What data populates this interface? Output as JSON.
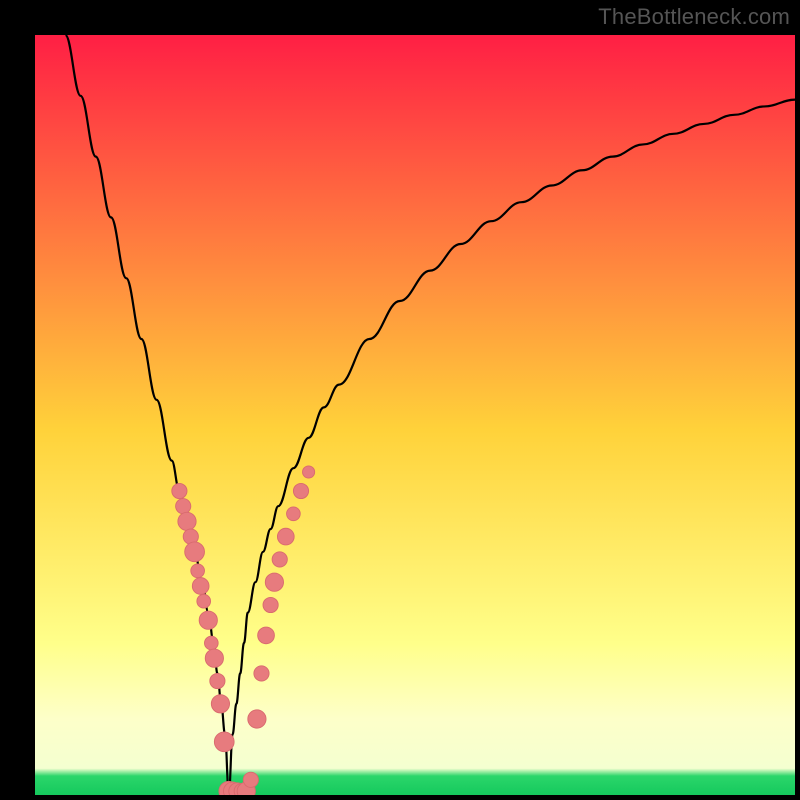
{
  "watermark": "TheBottleneck.com",
  "colors": {
    "frame": "#000000",
    "grad_top": "#ff1f44",
    "grad_mid": "#ffd23a",
    "grad_low": "#ffff8a",
    "grad_band_pale": "#fdffc9",
    "grad_green": "#2bd66a",
    "curve": "#000000",
    "marker_fill": "#e77b7e",
    "marker_stroke": "#d96a6e"
  },
  "chart_data": {
    "type": "line",
    "title": "",
    "xlabel": "",
    "ylabel": "",
    "xlim": [
      0,
      100
    ],
    "ylim": [
      0,
      100
    ],
    "minimum_x": 25.5,
    "series": [
      {
        "name": "bottleneck-curve",
        "x": [
          4,
          6,
          8,
          10,
          12,
          14,
          16,
          18,
          19,
          20,
          21,
          22,
          22.8,
          23.5,
          24,
          24.5,
          25,
          25.5,
          26,
          26.5,
          27,
          27.5,
          28,
          29,
          30,
          31,
          32,
          34,
          36,
          38,
          40,
          44,
          48,
          52,
          56,
          60,
          64,
          68,
          72,
          76,
          80,
          84,
          88,
          92,
          96,
          100
        ],
        "values": [
          100,
          92,
          84,
          76,
          68,
          60,
          52,
          44,
          40,
          36,
          32,
          28,
          24,
          20,
          16,
          12,
          8,
          0,
          8,
          12,
          16,
          20,
          24,
          28,
          32,
          35,
          38,
          43,
          47,
          51,
          54,
          60,
          65,
          69,
          72.5,
          75.5,
          78,
          80.2,
          82.2,
          84,
          85.6,
          87,
          88.3,
          89.5,
          90.6,
          91.5
        ]
      }
    ],
    "markers": [
      {
        "x": 19.0,
        "y": 40.0,
        "r": 1.0
      },
      {
        "x": 19.5,
        "y": 38.0,
        "r": 1.0
      },
      {
        "x": 20.0,
        "y": 36.0,
        "r": 1.2
      },
      {
        "x": 20.5,
        "y": 34.0,
        "r": 1.0
      },
      {
        "x": 21.0,
        "y": 32.0,
        "r": 1.3
      },
      {
        "x": 21.4,
        "y": 29.5,
        "r": 0.9
      },
      {
        "x": 21.8,
        "y": 27.5,
        "r": 1.1
      },
      {
        "x": 22.2,
        "y": 25.5,
        "r": 0.9
      },
      {
        "x": 22.8,
        "y": 23.0,
        "r": 1.2
      },
      {
        "x": 23.2,
        "y": 20.0,
        "r": 0.9
      },
      {
        "x": 23.6,
        "y": 18.0,
        "r": 1.2
      },
      {
        "x": 24.0,
        "y": 15.0,
        "r": 1.0
      },
      {
        "x": 24.4,
        "y": 12.0,
        "r": 1.2
      },
      {
        "x": 24.9,
        "y": 7.0,
        "r": 1.3
      },
      {
        "x": 25.5,
        "y": 0.5,
        "r": 1.3
      },
      {
        "x": 26.0,
        "y": 0.5,
        "r": 1.2
      },
      {
        "x": 26.6,
        "y": 0.5,
        "r": 1.1
      },
      {
        "x": 27.2,
        "y": 0.5,
        "r": 1.0
      },
      {
        "x": 27.8,
        "y": 0.5,
        "r": 1.2
      },
      {
        "x": 28.4,
        "y": 2.0,
        "r": 1.0
      },
      {
        "x": 29.2,
        "y": 10.0,
        "r": 1.2
      },
      {
        "x": 29.8,
        "y": 16.0,
        "r": 1.0
      },
      {
        "x": 30.4,
        "y": 21.0,
        "r": 1.1
      },
      {
        "x": 31.0,
        "y": 25.0,
        "r": 1.0
      },
      {
        "x": 31.5,
        "y": 28.0,
        "r": 1.2
      },
      {
        "x": 32.2,
        "y": 31.0,
        "r": 1.0
      },
      {
        "x": 33.0,
        "y": 34.0,
        "r": 1.1
      },
      {
        "x": 34.0,
        "y": 37.0,
        "r": 0.9
      },
      {
        "x": 35.0,
        "y": 40.0,
        "r": 1.0
      },
      {
        "x": 36.0,
        "y": 42.5,
        "r": 0.8
      }
    ]
  }
}
